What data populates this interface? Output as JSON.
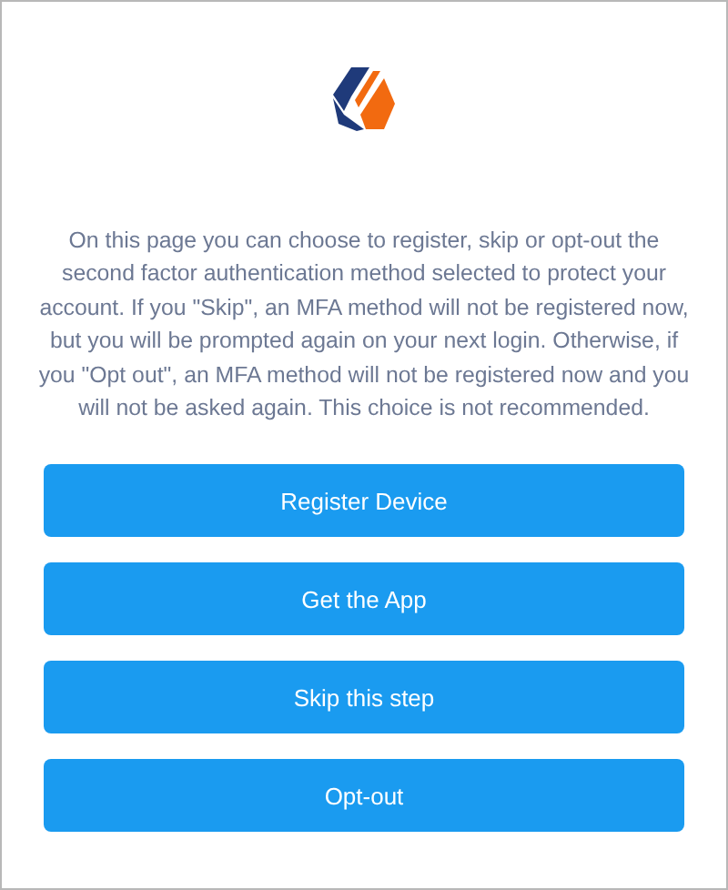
{
  "description": "On this page you can choose to register, skip or opt-out the second factor authentication method selected to protect your account. If you \"Skip\", an MFA method will not be registered now, but you will be prompted again on your next login. Otherwise, if you \"Opt out\", an MFA method will not be registered now and you will not be asked again. This choice is not recommended.",
  "buttons": [
    {
      "label": "Register Device"
    },
    {
      "label": "Get the App"
    },
    {
      "label": "Skip this step"
    },
    {
      "label": "Opt-out"
    }
  ]
}
